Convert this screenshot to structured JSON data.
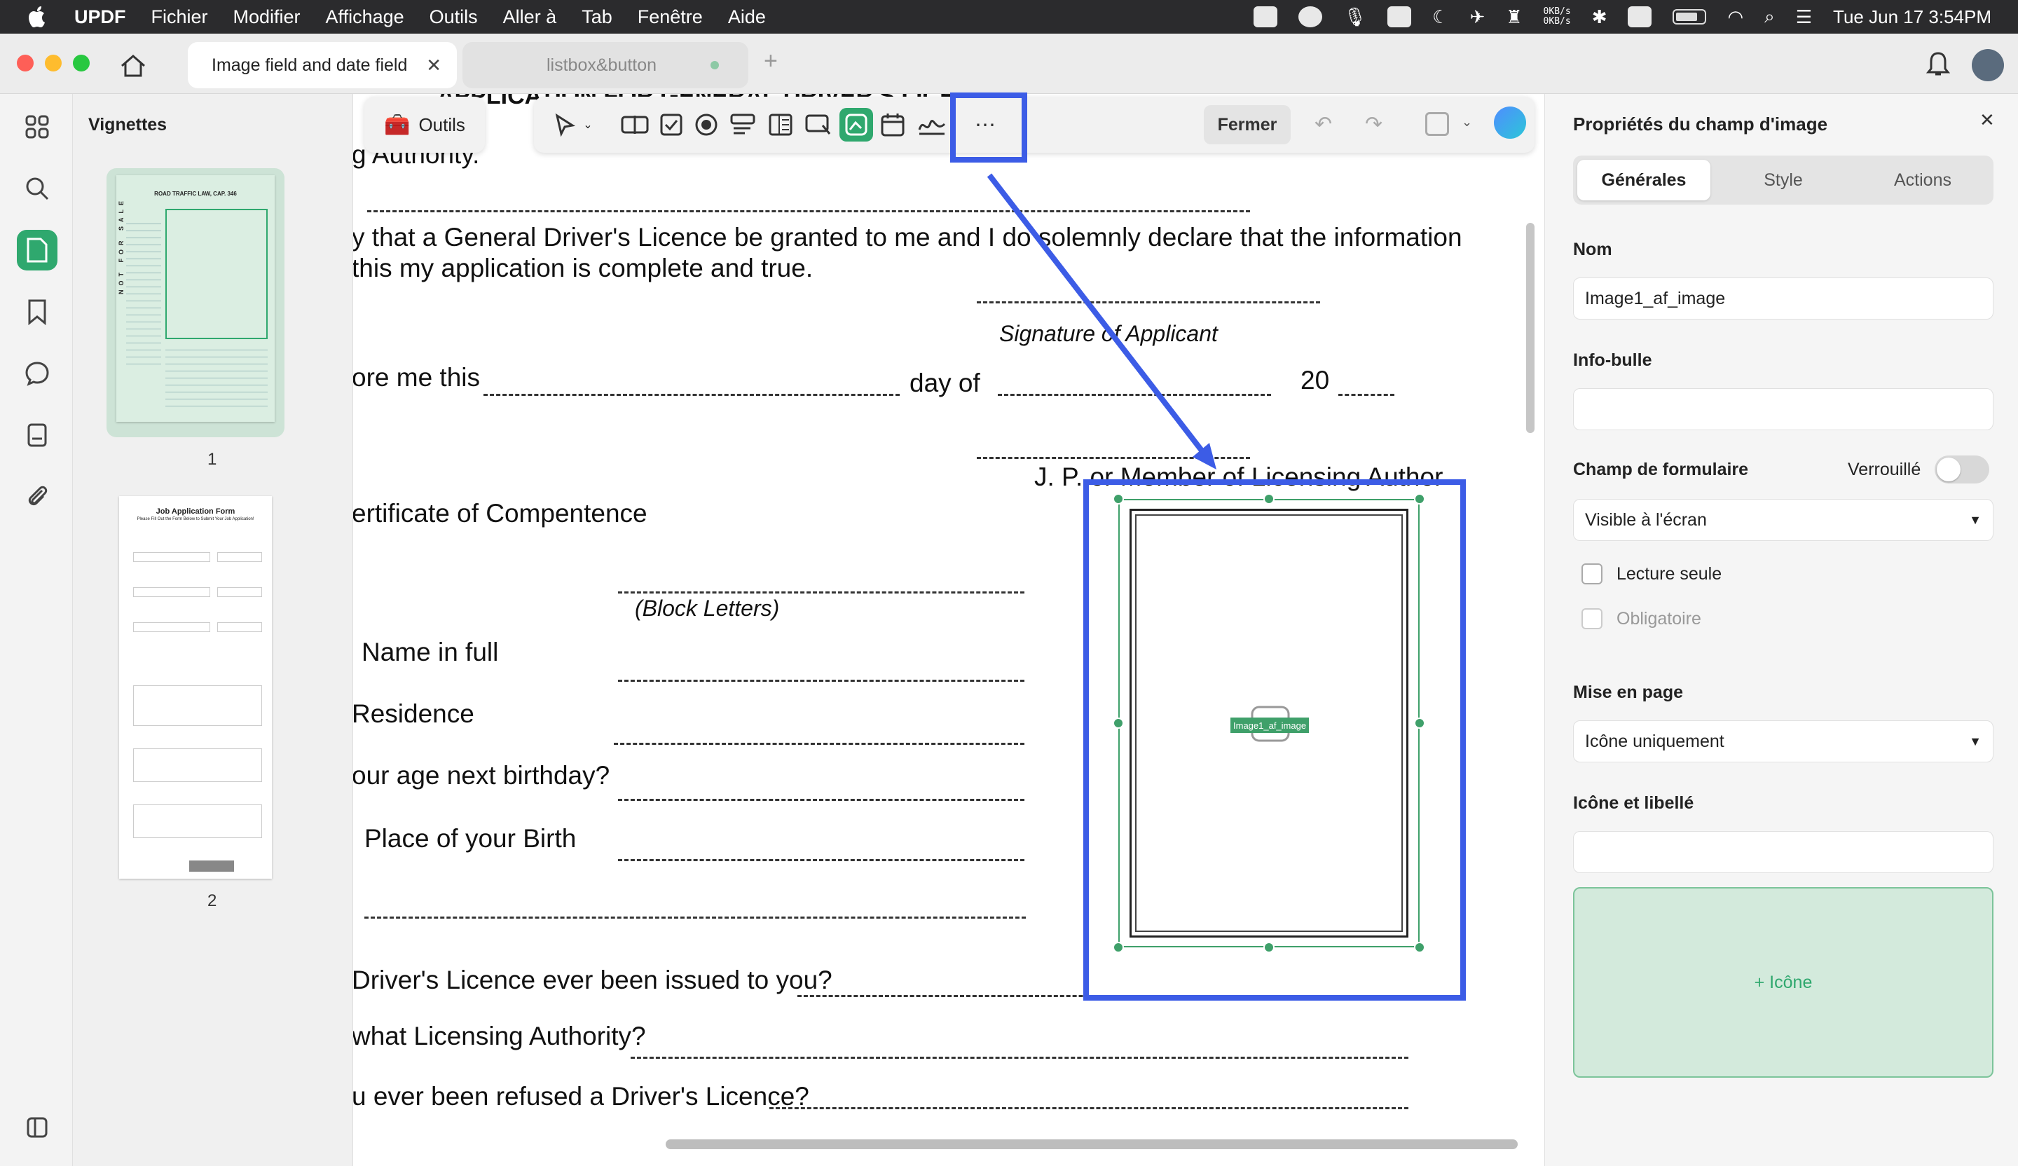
{
  "menubar": {
    "app": "UPDF",
    "items": [
      "Fichier",
      "Modifier",
      "Affichage",
      "Outils",
      "Aller à",
      "Tab",
      "Fenêtre",
      "Aide"
    ],
    "netspeed_up": "0KB/s",
    "netspeed_down": "0KB/s",
    "datetime": "Tue Jun 17  3:54PM"
  },
  "tabs": [
    {
      "label": "Image field and date field"
    },
    {
      "label": "listbox&button"
    }
  ],
  "thumbnails": {
    "title": "Vignettes",
    "pages": [
      {
        "number": "1"
      },
      {
        "number": "2"
      }
    ],
    "page1_heading": "ROAD TRAFFIC LAW, CAP. 346",
    "page1_side_text": "NOT FOR SALE",
    "page2_heading": "Job Application Form",
    "page2_sub": "Please Fill Out the Form Below to Submit Your Job Application!"
  },
  "toolbar": {
    "outils_label": "Outils",
    "fermer_label": "Fermer"
  },
  "document": {
    "line1": "g Authority.",
    "line2": "y that a General Driver's Licence be granted to me and I do solemnly declare that the information",
    "line3": "this my application is complete and true.",
    "signature": "Signature of Applicant",
    "before_me": "ore me this",
    "day_of": "day of",
    "year": "20",
    "jp": "J. P. or Member of Licensing Author",
    "certificate": "ertificate of Compentence",
    "block_letters": "(Block Letters)",
    "name": "Name in full",
    "residence": "Residence",
    "age": "our age next birthday?",
    "birth": "Place of your Birth",
    "licence_issued": "Driver's Licence ever been issued to you?",
    "licensing_authority": "what Licensing Authority?",
    "refused": "u ever been refused a Driver's Licence?",
    "header_cut": "APPLICATION FOR GENERAL DRIVER'S LICENCE",
    "image_field_label": "Image1_af_image"
  },
  "properties": {
    "title": "Propriétés du champ d'image",
    "tabs": [
      "Générales",
      "Style",
      "Actions"
    ],
    "nom_label": "Nom",
    "nom_value": "Image1_af_image",
    "tooltip_label": "Info-bulle",
    "tooltip_value": "",
    "form_field_label": "Champ de formulaire",
    "locked_label": "Verrouillé",
    "visibility_value": "Visible à l'écran",
    "readonly_label": "Lecture seule",
    "required_label": "Obligatoire",
    "layout_label": "Mise en page",
    "layout_value": "Icône uniquement",
    "icon_label_title": "Icône et libellé",
    "icon_label_value": "",
    "add_icon": "+ Icône"
  },
  "colors": {
    "accent": "#2fa86e",
    "highlight": "#3c5ce6"
  }
}
